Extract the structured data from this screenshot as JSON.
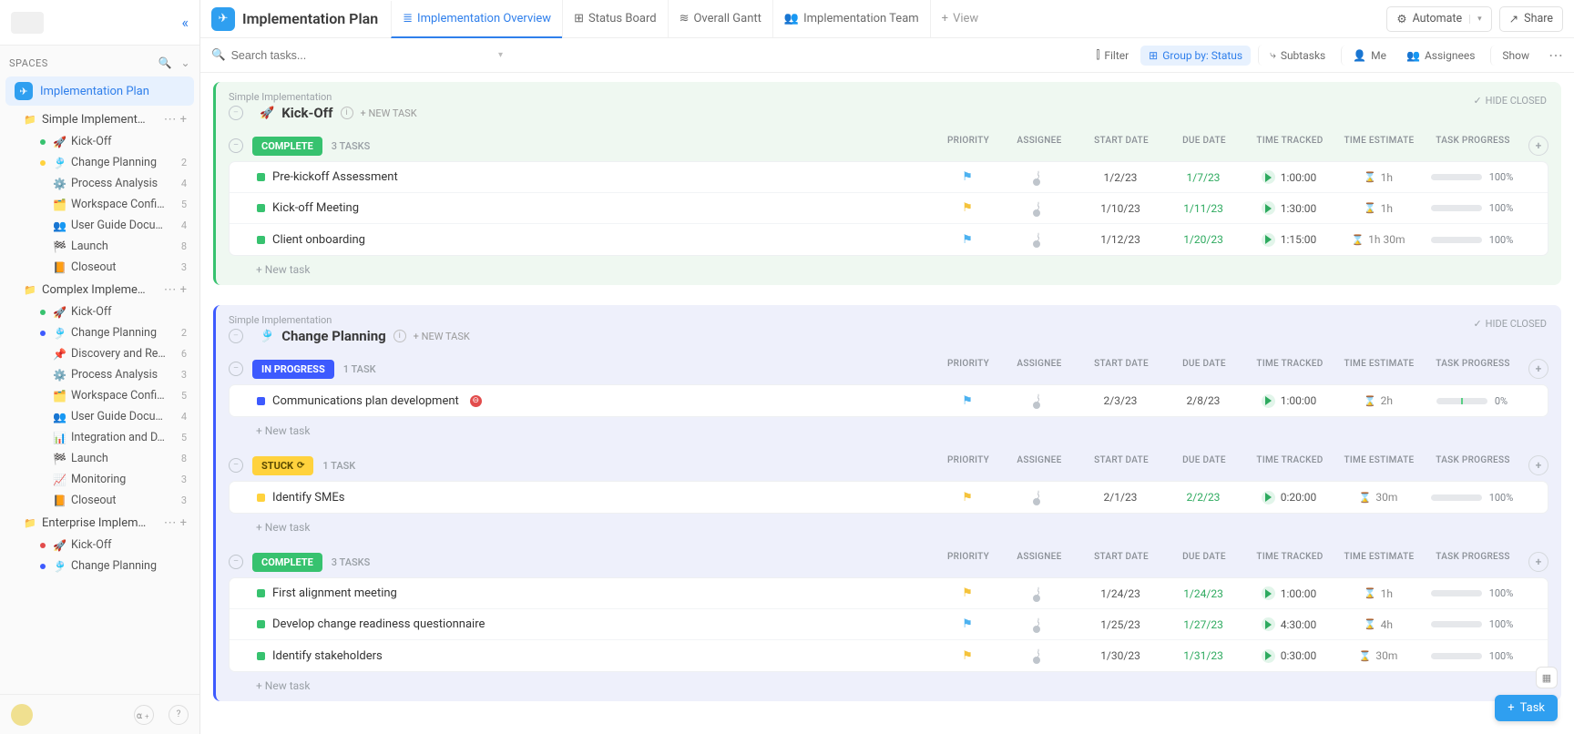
{
  "header": {
    "title": "Implementation Plan",
    "views": [
      {
        "label": "Implementation Overview",
        "active": true
      },
      {
        "label": "Status Board",
        "active": false
      },
      {
        "label": "Overall Gantt",
        "active": false
      },
      {
        "label": "Implementation Team",
        "active": false
      }
    ],
    "add_view": "View",
    "automate": "Automate",
    "share": "Share"
  },
  "toolbar": {
    "search_placeholder": "Search tasks...",
    "filter": "Filter",
    "group_by": "Group by: Status",
    "subtasks": "Subtasks",
    "me": "Me",
    "assignees": "Assignees",
    "show": "Show"
  },
  "sidebar": {
    "spaces_label": "SPACES",
    "space_name": "Implementation Plan",
    "folders": [
      {
        "name": "Simple Implement…",
        "lists": [
          {
            "emoji": "🚀",
            "name": "Kick-Off",
            "count": "",
            "dot": "#37c26f"
          },
          {
            "emoji": "🎐",
            "name": "Change Planning",
            "count": "2",
            "dot": "#ffd23d"
          },
          {
            "emoji": "⚙️",
            "name": "Process Analysis",
            "count": "4",
            "dot": ""
          },
          {
            "emoji": "🗂️",
            "name": "Workspace Confi…",
            "count": "5",
            "dot": ""
          },
          {
            "emoji": "👥",
            "name": "User Guide Docu…",
            "count": "4",
            "dot": ""
          },
          {
            "emoji": "🏁",
            "name": "Launch",
            "count": "8",
            "dot": ""
          },
          {
            "emoji": "📙",
            "name": "Closeout",
            "count": "3",
            "dot": ""
          }
        ]
      },
      {
        "name": "Complex Impleme…",
        "lists": [
          {
            "emoji": "🚀",
            "name": "Kick-Off",
            "count": "",
            "dot": "#37c26f"
          },
          {
            "emoji": "🎐",
            "name": "Change Planning",
            "count": "2",
            "dot": "#3d5afe"
          },
          {
            "emoji": "📌",
            "name": "Discovery and Re…",
            "count": "6",
            "dot": ""
          },
          {
            "emoji": "⚙️",
            "name": "Process Analysis",
            "count": "3",
            "dot": ""
          },
          {
            "emoji": "🗂️",
            "name": "Workspace Confi…",
            "count": "5",
            "dot": ""
          },
          {
            "emoji": "👥",
            "name": "User Guide Docu…",
            "count": "4",
            "dot": ""
          },
          {
            "emoji": "📊",
            "name": "Integration and D…",
            "count": "5",
            "dot": ""
          },
          {
            "emoji": "🏁",
            "name": "Launch",
            "count": "8",
            "dot": ""
          },
          {
            "emoji": "📈",
            "name": "Monitoring",
            "count": "3",
            "dot": ""
          },
          {
            "emoji": "📙",
            "name": "Closeout",
            "count": "3",
            "dot": ""
          }
        ]
      },
      {
        "name": "Enterprise Implem…",
        "lists": [
          {
            "emoji": "🚀",
            "name": "Kick-Off",
            "count": "",
            "dot": "#e24c4c"
          },
          {
            "emoji": "🎐",
            "name": "Change Planning",
            "count": "",
            "dot": "#3d5afe"
          }
        ]
      }
    ]
  },
  "columns": {
    "priority": "PRIORITY",
    "assignee": "ASSIGNEE",
    "start": "START DATE",
    "due": "DUE DATE",
    "tracked": "TIME TRACKED",
    "estimate": "TIME ESTIMATE",
    "progress": "TASK PROGRESS"
  },
  "labels": {
    "hide_closed": "HIDE CLOSED",
    "new_task_header": "+ NEW TASK",
    "new_task_row": "+ New task",
    "task_btn": "Task",
    "breadcrumb": "Simple Implementation"
  },
  "sections": [
    {
      "accent": "green",
      "title": "Kick-Off",
      "emoji": "🚀",
      "groups": [
        {
          "status": "COMPLETE",
          "status_class": "st-complete",
          "count": "3 TASKS",
          "tasks": [
            {
              "name": "Pre-kickoff Assessment",
              "sq": "sq-complete",
              "flag": "🚩",
              "flag_color": "#4db2f0",
              "sd": "1/2/23",
              "dd": "1/7/23",
              "tt": "1:00:00",
              "te": "1h",
              "pg": 100
            },
            {
              "name": "Kick-off Meeting",
              "sq": "sq-complete",
              "flag": "🚩",
              "flag_color": "#f5c33b",
              "sd": "1/10/23",
              "dd": "1/11/23",
              "tt": "1:30:00",
              "te": "1h",
              "pg": 100
            },
            {
              "name": "Client onboarding",
              "sq": "sq-complete",
              "flag": "🚩",
              "flag_color": "#4db2f0",
              "sd": "1/12/23",
              "dd": "1/20/23",
              "tt": "1:15:00",
              "te": "1h 30m",
              "pg": 100
            }
          ]
        }
      ]
    },
    {
      "accent": "blue",
      "title": "Change Planning",
      "emoji": "🎐",
      "groups": [
        {
          "status": "IN PROGRESS",
          "status_class": "st-progress",
          "count": "1 TASK",
          "tasks": [
            {
              "name": "Communications plan development",
              "sq": "sq-progress",
              "blocked": true,
              "flag": "🚩",
              "flag_color": "#4db2f0",
              "sd": "2/3/23",
              "dd": "2/8/23",
              "dd_plain": true,
              "tt": "1:00:00",
              "te": "2h",
              "pg": 0
            }
          ]
        },
        {
          "status": "STUCK",
          "status_class": "st-stuck",
          "count": "1 TASK",
          "stuck": true,
          "tasks": [
            {
              "name": "Identify SMEs",
              "sq": "sq-stuck",
              "flag": "🚩",
              "flag_color": "#f5c33b",
              "sd": "2/1/23",
              "dd": "2/2/23",
              "tt": "0:20:00",
              "te": "30m",
              "pg": 100
            }
          ]
        },
        {
          "status": "COMPLETE",
          "status_class": "st-complete",
          "count": "3 TASKS",
          "tasks": [
            {
              "name": "First alignment meeting",
              "sq": "sq-complete",
              "flag": "🚩",
              "flag_color": "#f5c33b",
              "sd": "1/24/23",
              "dd": "1/24/23",
              "tt": "1:00:00",
              "te": "1h",
              "pg": 100
            },
            {
              "name": "Develop change readiness questionnaire",
              "sq": "sq-complete",
              "flag": "🚩",
              "flag_color": "#4db2f0",
              "sd": "1/25/23",
              "dd": "1/27/23",
              "tt": "4:30:00",
              "te": "4h",
              "pg": 100
            },
            {
              "name": "Identify stakeholders",
              "sq": "sq-complete",
              "flag": "🚩",
              "flag_color": "#f5c33b",
              "sd": "1/30/23",
              "dd": "1/31/23",
              "tt": "0:30:00",
              "te": "30m",
              "pg": 100
            }
          ]
        }
      ]
    }
  ]
}
